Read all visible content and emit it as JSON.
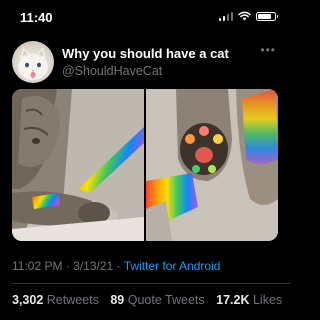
{
  "status_bar": {
    "time": "11:40",
    "battery_level": 0.85
  },
  "tweet": {
    "author_name": "Why you should have a cat",
    "author_handle": "@ShouldHaveCat",
    "more_icon": "more-horizontal-icon",
    "timestamp_time": "11:02 PM",
    "timestamp_date": "3/13/21",
    "separator": "·",
    "source": "Twitter for Android",
    "stats": {
      "retweets_count": "3,302",
      "retweets_label": "Retweets",
      "quote_tweets_count": "89",
      "quote_tweets_label": "Quote Tweets",
      "likes_count": "17.2K",
      "likes_label": "Likes"
    }
  },
  "colors": {
    "background": "#000000",
    "secondary_text": "#71767b",
    "link": "#1d9bf0"
  }
}
